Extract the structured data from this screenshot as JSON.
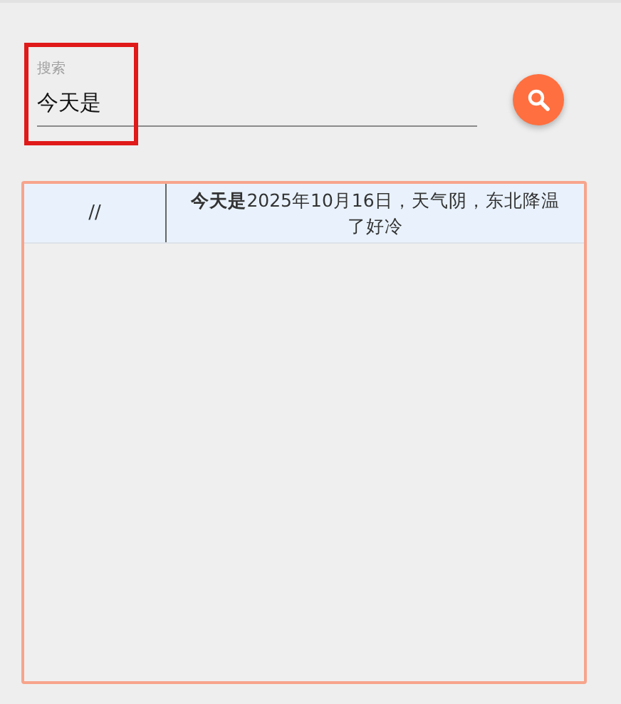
{
  "search": {
    "label": "搜索",
    "value": "今天是",
    "highlighted": true
  },
  "results": {
    "rows": [
      {
        "column_1": "//",
        "column_2": "**今天是**2025年10月16日，天气阴，东北降温了好冷"
      }
    ]
  }
}
